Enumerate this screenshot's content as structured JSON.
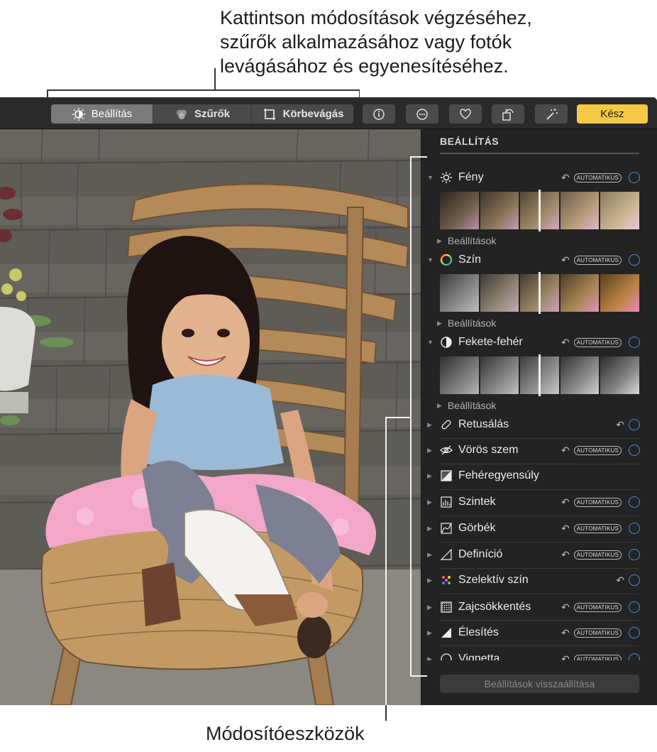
{
  "callouts": {
    "top_line1": "Kattintson módosítások végzéséhez,",
    "top_line2": "szűrők alkalmazásához vagy fotók",
    "top_line3": "levágásához és egyenesítéséhez.",
    "bottom": "Módosítóeszközök"
  },
  "toolbar": {
    "segments": [
      "Beállítás",
      "Szűrők",
      "Körbevágás"
    ],
    "active_segment": "Beállítás",
    "icon_buttons": [
      "info-icon",
      "more-icon",
      "heart-icon",
      "rotate-icon",
      "magic-wand-icon"
    ],
    "done_label": "Kész",
    "done_color": "#f6c945"
  },
  "panel": {
    "title": "BEÁLLÍTÁS",
    "auto_label": "AUTOMATIKUS",
    "options_label": "Beállítások",
    "reset_label": "Beállítások visszaállítása",
    "accent": "#3b8ef0",
    "adjustments": [
      {
        "label": "Fény",
        "icon": "sun-icon",
        "expanded": true,
        "auto": true
      },
      {
        "label": "Szín",
        "icon": "color-wheel-icon",
        "expanded": true,
        "auto": true
      },
      {
        "label": "Fekete-fehér",
        "icon": "half-circle-icon",
        "expanded": true,
        "auto": true
      },
      {
        "label": "Retusálás",
        "icon": "bandage-icon",
        "expanded": false,
        "auto": false
      },
      {
        "label": "Vörös szem",
        "icon": "eye-icon",
        "expanded": false,
        "auto": true
      },
      {
        "label": "Fehéregyensúly",
        "icon": "white-balance-icon",
        "expanded": false,
        "auto": false
      },
      {
        "label": "Szintek",
        "icon": "levels-icon",
        "expanded": false,
        "auto": true
      },
      {
        "label": "Görbék",
        "icon": "curves-icon",
        "expanded": false,
        "auto": true
      },
      {
        "label": "Definíció",
        "icon": "definition-icon",
        "expanded": false,
        "auto": true
      },
      {
        "label": "Szelektív szín",
        "icon": "selective-color-icon",
        "expanded": false,
        "auto": false
      },
      {
        "label": "Zajcsökkentés",
        "icon": "noise-icon",
        "expanded": false,
        "auto": true
      },
      {
        "label": "Élesítés",
        "icon": "sharpen-icon",
        "expanded": false,
        "auto": true
      },
      {
        "label": "Vignetta",
        "icon": "vignette-icon",
        "expanded": false,
        "auto": true
      }
    ]
  }
}
